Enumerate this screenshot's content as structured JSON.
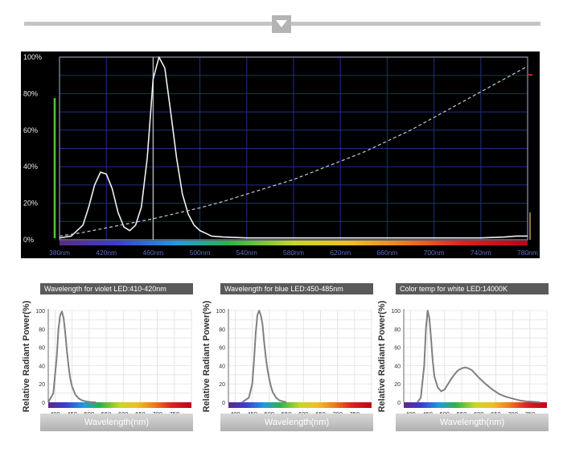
{
  "chart_data": [
    {
      "type": "line",
      "ylim": [
        0,
        100
      ],
      "xlim": [
        380,
        780
      ],
      "y_ticks": [
        "0%",
        "20%",
        "40%",
        "60%",
        "80%",
        "100%"
      ],
      "y_tick_values": [
        0,
        20,
        40,
        60,
        80,
        100
      ],
      "x_ticks": [
        "380nm",
        "420nm",
        "460nm",
        "500nm",
        "540nm",
        "580nm",
        "620nm",
        "660nm",
        "700nm",
        "740nm",
        "780nm"
      ],
      "x_tick_values": [
        380,
        420,
        460,
        500,
        540,
        580,
        620,
        660,
        700,
        740,
        780
      ],
      "grid": true,
      "marker_x": 460,
      "series": [
        {
          "style": "solid",
          "x": [
            380,
            390,
            400,
            405,
            410,
            415,
            420,
            425,
            430,
            435,
            440,
            445,
            450,
            455,
            460,
            465,
            470,
            475,
            480,
            485,
            490,
            495,
            500,
            510,
            520,
            540,
            560,
            580,
            600,
            620,
            640,
            660,
            680,
            700,
            720,
            740,
            760,
            770,
            780
          ],
          "y": [
            1,
            2,
            8,
            18,
            30,
            37,
            36,
            28,
            15,
            7,
            5,
            8,
            18,
            45,
            88,
            100,
            94,
            70,
            45,
            25,
            14,
            8,
            5,
            2,
            1.5,
            1,
            1,
            1,
            1,
            1,
            1,
            1,
            1,
            1,
            1,
            1,
            1.5,
            2,
            2
          ]
        },
        {
          "style": "dashed",
          "x": [
            380,
            400,
            420,
            440,
            460,
            480,
            500,
            520,
            540,
            560,
            580,
            600,
            620,
            640,
            660,
            680,
            700,
            720,
            740,
            760,
            780
          ],
          "y": [
            2,
            4,
            6.5,
            9,
            11.5,
            14.5,
            17.5,
            21,
            25,
            29,
            33,
            38,
            43,
            48,
            54,
            60,
            67,
            74,
            81,
            88,
            95
          ]
        }
      ]
    },
    {
      "type": "line",
      "title": "Wavelength for violet LED:410-420nm",
      "ylabel": "Relative Radiant Power(%)",
      "xlabel": "Wavelength(nm)",
      "xlim": [
        380,
        800
      ],
      "ylim": [
        0,
        100
      ],
      "x_ticks": [
        400,
        450,
        500,
        550,
        600,
        650,
        700,
        750
      ],
      "y_ticks": [
        0,
        20,
        40,
        60,
        80,
        100
      ],
      "x": [
        380,
        395,
        405,
        410,
        415,
        420,
        425,
        430,
        435,
        440,
        445,
        450,
        460,
        470,
        480,
        490,
        500,
        510,
        520
      ],
      "y": [
        0,
        10,
        50,
        80,
        95,
        99,
        92,
        75,
        55,
        38,
        25,
        17,
        8,
        4,
        2,
        1,
        0.5,
        0,
        0
      ]
    },
    {
      "type": "line",
      "title": "Wavelength for blue LED:450-485nm",
      "ylabel": "Relative Radiant Power(%)",
      "xlabel": "Wavelength(nm)",
      "xlim": [
        380,
        800
      ],
      "ylim": [
        0,
        100
      ],
      "x_ticks": [
        400,
        450,
        500,
        550,
        600,
        650,
        700,
        750
      ],
      "y_ticks": [
        0,
        20,
        40,
        60,
        80,
        100
      ],
      "x": [
        420,
        440,
        450,
        455,
        460,
        465,
        470,
        475,
        480,
        485,
        490,
        495,
        500,
        505,
        510,
        520,
        530,
        540,
        550
      ],
      "y": [
        0,
        5,
        20,
        45,
        75,
        95,
        100,
        95,
        85,
        65,
        48,
        35,
        25,
        17,
        11,
        5,
        2,
        1,
        0
      ]
    },
    {
      "type": "line",
      "title": "Color temp for white LED:14000K",
      "ylabel": "Relative Radiant Power(%)",
      "xlabel": "Wavelength(nm)",
      "xlim": [
        380,
        800
      ],
      "ylim": [
        0,
        100
      ],
      "x_ticks": [
        400,
        450,
        500,
        550,
        600,
        650,
        700,
        750
      ],
      "y_ticks": [
        0,
        20,
        40,
        60,
        80,
        100
      ],
      "x": [
        420,
        430,
        440,
        445,
        450,
        455,
        460,
        465,
        470,
        480,
        490,
        500,
        510,
        520,
        530,
        540,
        550,
        560,
        570,
        580,
        590,
        600,
        620,
        640,
        660,
        680,
        700,
        720,
        740,
        760,
        780
      ],
      "y": [
        0,
        5,
        40,
        80,
        100,
        92,
        70,
        45,
        28,
        16,
        12,
        14,
        20,
        26,
        31,
        35,
        37,
        38,
        37,
        35,
        31,
        27,
        20,
        14,
        9,
        6,
        4,
        2,
        1,
        0.5,
        0
      ]
    }
  ]
}
